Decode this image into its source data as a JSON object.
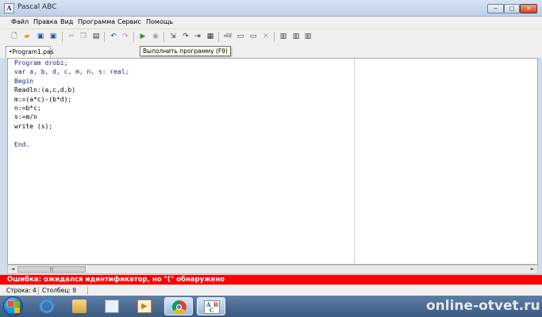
{
  "window": {
    "title": "Pascal ABC",
    "icon_letter": "A",
    "minimize_glyph": "─",
    "maximize_glyph": "□",
    "close_glyph": "✕"
  },
  "menu": [
    "Файл",
    "Правка",
    "Вид",
    "Программа",
    "Сервис",
    "Помощь"
  ],
  "toolbar": {
    "icons": [
      "new-file-icon",
      "open-folder-icon",
      "save-icon",
      "save-all-icon",
      "cut-icon",
      "copy-icon",
      "paste-icon",
      "undo-icon",
      "redo-icon",
      "run-icon",
      "stop-icon",
      "step-into-icon",
      "step-over-icon",
      "run-to-cursor-icon",
      "watch-icon",
      "compile-icon",
      "tools-icon",
      "monitor-icon",
      "close-debug-icon",
      "window-1-icon",
      "window-2-icon",
      "window-3-icon"
    ],
    "tooltip": "Выполнить программу (F9)"
  },
  "tabs": [
    {
      "label": "•Program1.pas",
      "active": true
    }
  ],
  "editor": {
    "lines": [
      "Program drobi;",
      "var a, b, d, c, m, n, s: real;",
      "Begin",
      "Readln:(a,c,d,b)",
      "m:=(a*c)-(b*d);",
      "n:=b*c;",
      "s:=m/n",
      "write (s);",
      "",
      "End."
    ]
  },
  "scrollbar": {
    "left_arrow": "◄",
    "right_arrow": "►",
    "thumb_grip": "|||"
  },
  "error": {
    "text": "Ошибка: ожидался идентификатор, но \"(\" обнаружено",
    "color": "#ff0000"
  },
  "status": {
    "line": "Строка: 4",
    "column": "Столбец: 9"
  },
  "taskbar": {
    "apps": [
      "internet-explorer-icon",
      "file-explorer-icon",
      "image-viewer-icon",
      "media-player-icon",
      "chrome-icon",
      "pascal-abc-icon"
    ],
    "pascal_icon_letters": [
      "A",
      "B",
      "C"
    ],
    "watermark": "online-otvet.ru"
  },
  "colors": {
    "keyword": "#1b1d8f",
    "error_bg": "#ff0000",
    "run_green": "#17a01b"
  }
}
